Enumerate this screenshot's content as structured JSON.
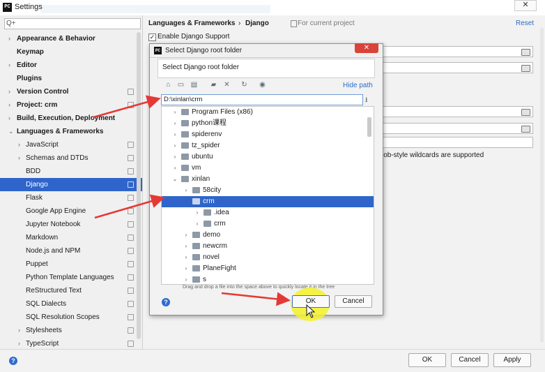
{
  "window": {
    "title": "Settings",
    "app_icon": "PC",
    "close": "✕"
  },
  "search": {
    "placeholder": "Q+"
  },
  "sidebar": {
    "items": [
      {
        "label": "Appearance & Behavior",
        "arrow": "›",
        "bold": true
      },
      {
        "label": "Keymap",
        "bold": true
      },
      {
        "label": "Editor",
        "arrow": "›",
        "bold": true
      },
      {
        "label": "Plugins",
        "bold": true
      },
      {
        "label": "Version Control",
        "arrow": "›",
        "bold": true
      },
      {
        "label": "Project: crm",
        "arrow": "›",
        "bold": true
      },
      {
        "label": "Build, Execution, Deployment",
        "arrow": "›",
        "bold": true
      },
      {
        "label": "Languages & Frameworks",
        "arrow": "⌄",
        "bold": true
      },
      {
        "label": "JavaScript",
        "arrow": "›"
      },
      {
        "label": "Schemas and DTDs",
        "arrow": "›"
      },
      {
        "label": "BDD"
      },
      {
        "label": "Django",
        "selected": true
      },
      {
        "label": "Flask"
      },
      {
        "label": "Google App Engine"
      },
      {
        "label": "Jupyter Notebook"
      },
      {
        "label": "Markdown"
      },
      {
        "label": "Node.js and NPM"
      },
      {
        "label": "Puppet"
      },
      {
        "label": "Python Template Languages"
      },
      {
        "label": "ReStructured Text"
      },
      {
        "label": "SQL Dialects"
      },
      {
        "label": "SQL Resolution Scopes"
      },
      {
        "label": "Stylesheets",
        "arrow": "›"
      },
      {
        "label": "TypeScript",
        "arrow": "›"
      }
    ]
  },
  "content": {
    "breadcrumb_parent": "Languages & Frameworks",
    "breadcrumb_sep": "›",
    "breadcrumb_current": "Django",
    "scope": "For current project",
    "reset": "Reset",
    "enable_label": "Enable Django Support",
    "enable_checked": "✓",
    "wildcard_note": "lob-style wildcards are supported"
  },
  "dialog": {
    "title": "Select Django root folder",
    "subtitle": "Select Django root folder",
    "close": "✕",
    "hide_path": "Hide path",
    "path_value": "D:\\xinlan\\crm",
    "drag_hint": "Drag and drop a file into the space above to quickly locate it in the tree",
    "ok": "OK",
    "cancel": "Cancel",
    "help": "?",
    "tree": [
      {
        "label": "Program Files (x86)",
        "arrow": "›",
        "level": 1
      },
      {
        "label": "python课程",
        "arrow": "›",
        "level": 1
      },
      {
        "label": "spiderenv",
        "arrow": "›",
        "level": 1
      },
      {
        "label": "tz_spider",
        "arrow": "›",
        "level": 1
      },
      {
        "label": "ubuntu",
        "arrow": "›",
        "level": 1
      },
      {
        "label": "vm",
        "arrow": "›",
        "level": 1
      },
      {
        "label": "xinlan",
        "arrow": "⌄",
        "level": 1
      },
      {
        "label": "58city",
        "arrow": "›",
        "level": 2
      },
      {
        "label": "crm",
        "arrow": "⌄",
        "level": 2,
        "selected": true
      },
      {
        "label": ".idea",
        "arrow": "›",
        "level": 3
      },
      {
        "label": "crm",
        "arrow": "›",
        "level": 3
      },
      {
        "label": "demo",
        "arrow": "›",
        "level": 2
      },
      {
        "label": "newcrm",
        "arrow": "›",
        "level": 2
      },
      {
        "label": "novel",
        "arrow": "›",
        "level": 2
      },
      {
        "label": "PlaneFight",
        "arrow": "›",
        "level": 2
      },
      {
        "label": "s",
        "arrow": "›",
        "level": 2
      }
    ]
  },
  "footer": {
    "ok": "OK",
    "cancel": "Cancel",
    "apply": "Apply",
    "help": "?"
  },
  "colors": {
    "selection": "#2f65ca",
    "link": "#2a6cc7",
    "annotation_arrow": "#e53935",
    "highlight": "#f4f22a"
  }
}
